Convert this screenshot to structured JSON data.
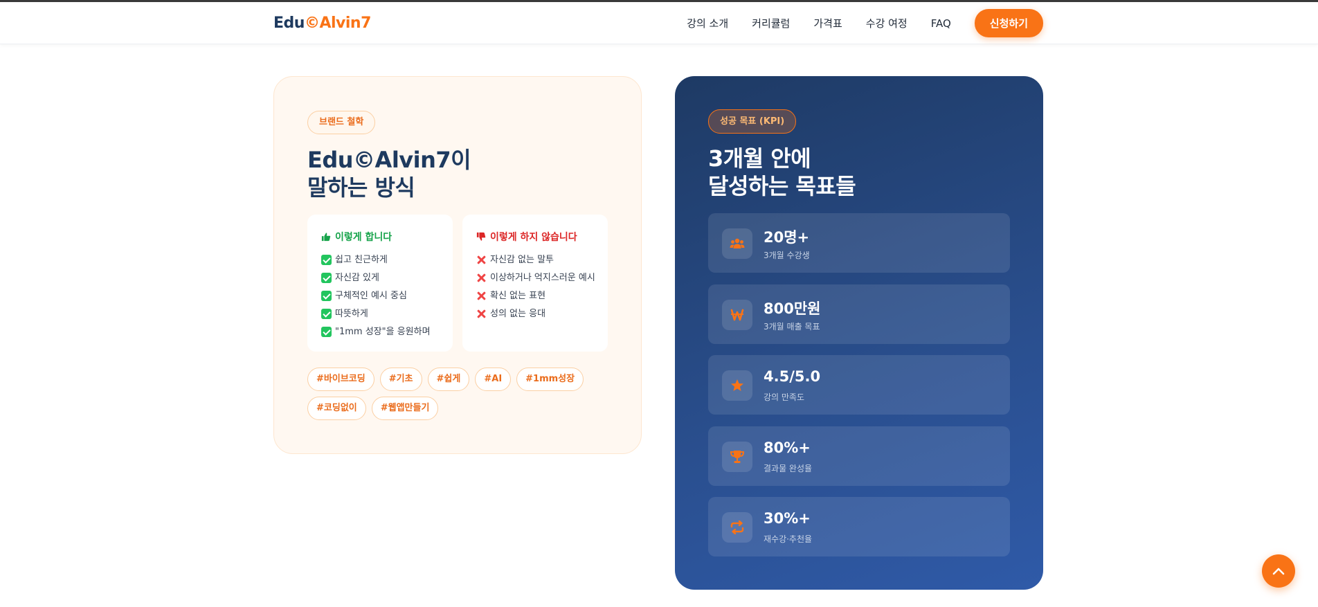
{
  "header": {
    "logo_part1": "Edu",
    "logo_part2": "©Alvin7",
    "nav": [
      "강의 소개",
      "커리큘럼",
      "가격표",
      "수강 여정",
      "FAQ"
    ],
    "cta": "신청하기"
  },
  "brand": {
    "badge": "브랜드 철학",
    "title_line1": "Edu©Alvin7이",
    "title_line2": "말하는 방식",
    "do_title": "이렇게 합니다",
    "do_items": [
      "쉽고 친근하게",
      "자신감 있게",
      "구체적인 예시 중심",
      "따뜻하게",
      "\"1mm 성장\"을 응원하며"
    ],
    "dont_title": "이렇게 하지 않습니다",
    "dont_items": [
      "자신감 없는 말투",
      "이상하거나 억지스러운 예시",
      "확신 없는 표현",
      "성의 없는 응대"
    ],
    "tags": [
      "#바이브코딩",
      "#기초",
      "#쉽게",
      "#AI",
      "#1mm성장",
      "#코딩없이",
      "#웹앱만들기"
    ]
  },
  "kpi": {
    "badge": "성공 목표 (KPI)",
    "title_line1": "3개월 안에",
    "title_line2": "달성하는 목표들",
    "items": [
      {
        "value": "20명+",
        "label": "3개월 수강생",
        "icon": "users-icon"
      },
      {
        "value": "800만원",
        "label": "3개월 매출 목표",
        "icon": "won-icon"
      },
      {
        "value": "4.5/5.0",
        "label": "강의 만족도",
        "icon": "star-icon"
      },
      {
        "value": "80%+",
        "label": "결과물 완성율",
        "icon": "trophy-icon"
      },
      {
        "value": "30%+",
        "label": "재수강·추천율",
        "icon": "repeat-icon"
      }
    ]
  },
  "colors": {
    "accent": "#f97316",
    "navy": "#1e3a5f",
    "success": "#16a34a",
    "danger": "#dc2626"
  }
}
